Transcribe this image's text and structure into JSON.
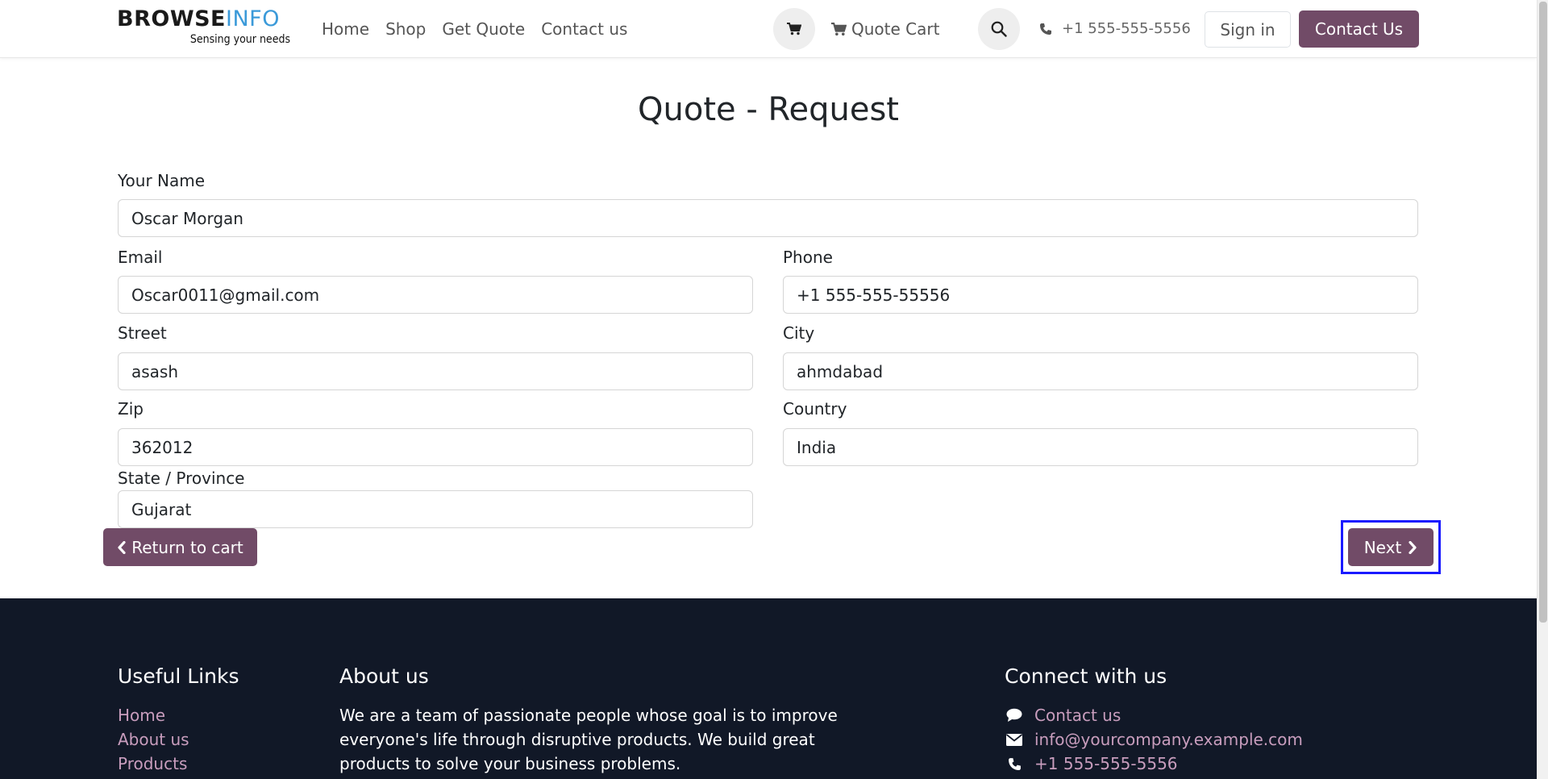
{
  "header": {
    "logo_main_dark": "BROWSE",
    "logo_main_light": "INFO",
    "logo_tagline": "Sensing your needs",
    "nav": [
      "Home",
      "Shop",
      "Get Quote",
      "Contact us"
    ],
    "quote_cart_label": "Quote Cart",
    "phone": "+1 555-555-5556",
    "sign_in_label": "Sign in",
    "contact_us_label": "Contact Us"
  },
  "form": {
    "title": "Quote - Request",
    "name_label": "Your Name",
    "name_value": "Oscar Morgan",
    "email_label": "Email",
    "email_value": "Oscar0011@gmail.com",
    "phone_label": "Phone",
    "phone_value": "+1 555-555-55556",
    "street_label": "Street",
    "street_value": "asash",
    "city_label": "City",
    "city_value": "ahmdabad",
    "zip_label": "Zip",
    "zip_value": "362012",
    "country_label": "Country",
    "country_value": "India",
    "state_label": "State / Province",
    "state_value": "Gujarat",
    "return_label": "Return to cart",
    "next_label": "Next"
  },
  "footer": {
    "useful_links_title": "Useful Links",
    "useful_links": [
      "Home",
      "About us",
      "Products"
    ],
    "about_title": "About us",
    "about_text": "We are a team of passionate people whose goal is to improve everyone's life through disruptive products. We build great products to solve your business problems.",
    "connect_title": "Connect with us",
    "connect_contact": "Contact us",
    "connect_email": "info@yourcompany.example.com",
    "connect_phone": "+1 555-555-5556"
  },
  "colors": {
    "primary": "#714b67",
    "footer_bg": "#111827",
    "footer_link": "#c89dbd",
    "logo_accent": "#3b9ad9",
    "focus_outline": "#1a1aff"
  },
  "icons": [
    "cart-icon",
    "search-icon",
    "phone-icon",
    "chevron-left-icon",
    "chevron-right-icon",
    "comment-icon",
    "envelope-icon"
  ]
}
